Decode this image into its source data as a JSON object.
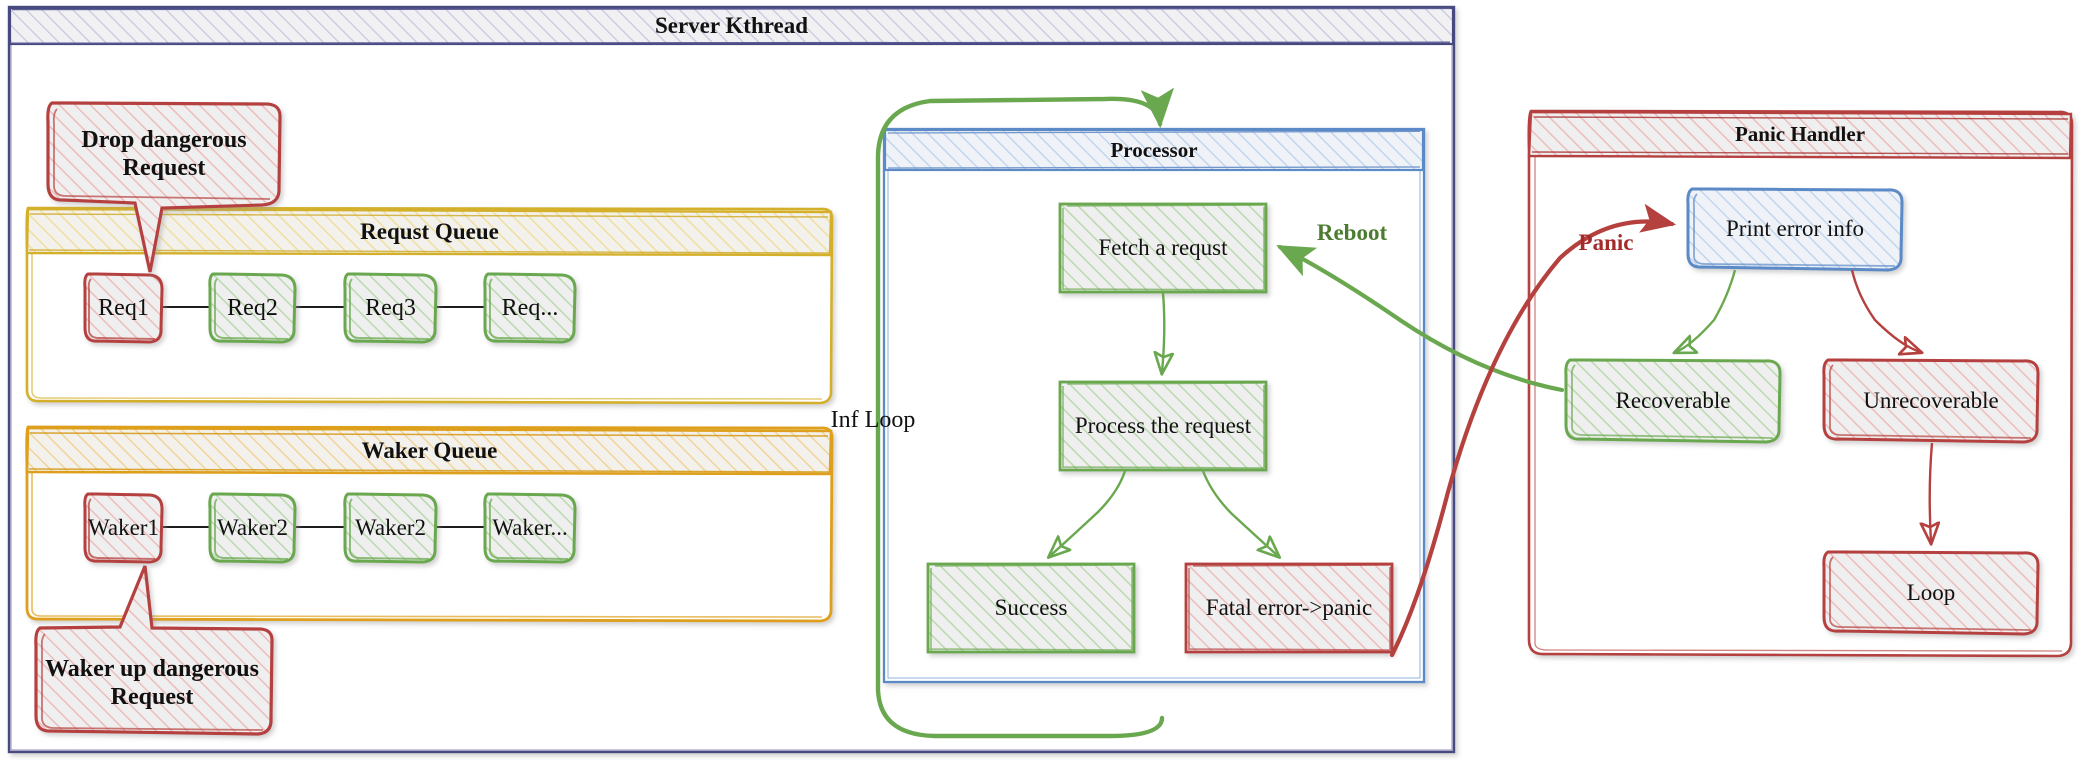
{
  "diagram": {
    "title": "Server Kthread",
    "type": "flowchart",
    "containers": [
      {
        "id": "server",
        "label": "Server Kthread",
        "color": "#4a4a82"
      },
      {
        "id": "request_queue",
        "label": "Requst Queue",
        "color": "#d4b02a"
      },
      {
        "id": "waker_queue",
        "label": "Waker Queue",
        "color": "#dea01a"
      },
      {
        "id": "processor",
        "label": "Processor",
        "color": "#5b8ac7"
      },
      {
        "id": "panic_handler",
        "label": "Panic Handler",
        "color": "#b5413f"
      }
    ],
    "request_queue_items": [
      {
        "label": "Req1",
        "state": "danger"
      },
      {
        "label": "Req2",
        "state": "ok"
      },
      {
        "label": "Req3",
        "state": "ok"
      },
      {
        "label": "Req...",
        "state": "ok"
      }
    ],
    "waker_queue_items": [
      {
        "label": "Waker1",
        "state": "danger"
      },
      {
        "label": "Waker2",
        "state": "ok"
      },
      {
        "label": "Waker2",
        "state": "ok"
      },
      {
        "label": "Waker...",
        "state": "ok"
      }
    ],
    "callouts": [
      {
        "id": "drop-dangerous-request",
        "label": "Drop dangerous Request",
        "line1": "Drop dangerous",
        "line2": "Request",
        "state": "danger"
      },
      {
        "id": "waker-up-dangerous-request",
        "label": "Waker up dangerous Request",
        "line1": "Waker up dangerous",
        "line2": "Request",
        "state": "danger"
      }
    ],
    "processor_nodes": [
      {
        "id": "fetch",
        "label": "Fetch a requst",
        "state": "ok"
      },
      {
        "id": "process",
        "label": "Process the request",
        "state": "ok"
      },
      {
        "id": "success",
        "label": "Success",
        "state": "ok"
      },
      {
        "id": "fatal",
        "label": "Fatal error->panic",
        "state": "danger"
      }
    ],
    "panic_nodes": [
      {
        "id": "print",
        "label": "Print error info",
        "state": "info"
      },
      {
        "id": "recoverable",
        "label": "Recoverable",
        "state": "ok"
      },
      {
        "id": "unrecoverable",
        "label": "Unrecoverable",
        "state": "danger"
      },
      {
        "id": "loop",
        "label": "Loop",
        "state": "danger"
      }
    ],
    "edge_labels": [
      {
        "id": "inf-loop",
        "label": "Inf Loop",
        "color": "#111111"
      },
      {
        "id": "reboot",
        "label": "Reboot",
        "color": "#4c7c2f"
      },
      {
        "id": "panic",
        "label": "Panic",
        "color": "#a32b2b"
      }
    ],
    "colors": {
      "purple": "#4a4a82",
      "yellow": "#d4b02a",
      "orange": "#dea01a",
      "blue": "#5b8ac7",
      "red": "#b5413f",
      "green": "#6aa84f",
      "fill_gray": "#efefef",
      "text": "#111111"
    }
  }
}
